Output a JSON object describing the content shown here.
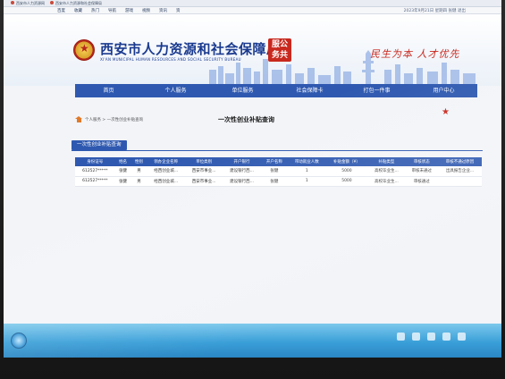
{
  "browser": {
    "tabs": [
      "西安市人力资源网",
      "西安市人力资源和社会保障局"
    ],
    "bookmarks": [
      "百度",
      "收藏",
      "热门",
      "导航",
      "游戏",
      "视频",
      "资讯",
      "资"
    ],
    "status_right": "2023年9月21日 星期四  张健  退出"
  },
  "header": {
    "title": "西安市人力资源和社会保障局",
    "subtitle": "XI'AN MUNICIPAL HUMAN RESOURCES AND SOCIAL SECURITY BUREAU",
    "stamp_line1": "服公",
    "stamp_line2": "务共",
    "slogan": "民生为本 人才优先"
  },
  "nav": [
    "首页",
    "个人服务",
    "单位服务",
    "社会保障卡",
    "打包一件事",
    "用户中心"
  ],
  "breadcrumb": "个人服务 > 一次性创业补贴查询",
  "page_title": "一次性创业补贴查询",
  "section_label": "一次性创业补贴查询",
  "table": {
    "headers": [
      "身份证号",
      "姓名",
      "性别",
      "领办企业名称",
      "单位类别",
      "开户银行",
      "开户名称",
      "带动就业人数",
      "补贴金额（¥）",
      "补贴类型",
      "审核状态",
      "审核不通过原因"
    ],
    "rows": [
      [
        "612527*****",
        "张健",
        "男",
        "经西创业城...",
        "西安市事业...",
        "建设银行西...",
        "张健",
        "1",
        "5000",
        "高校毕业生...",
        "审核未通过",
        "出具报告企业..."
      ],
      [
        "612527*****",
        "张健",
        "男",
        "经西创业城...",
        "西安市事业...",
        "建设银行西...",
        "张健",
        "1",
        "5000",
        "高校毕业生...",
        "审核通过",
        ""
      ]
    ]
  },
  "colors": {
    "primary": "#2f59b0",
    "accent_red": "#c8281e",
    "taskbar": "#3a9fd8"
  }
}
